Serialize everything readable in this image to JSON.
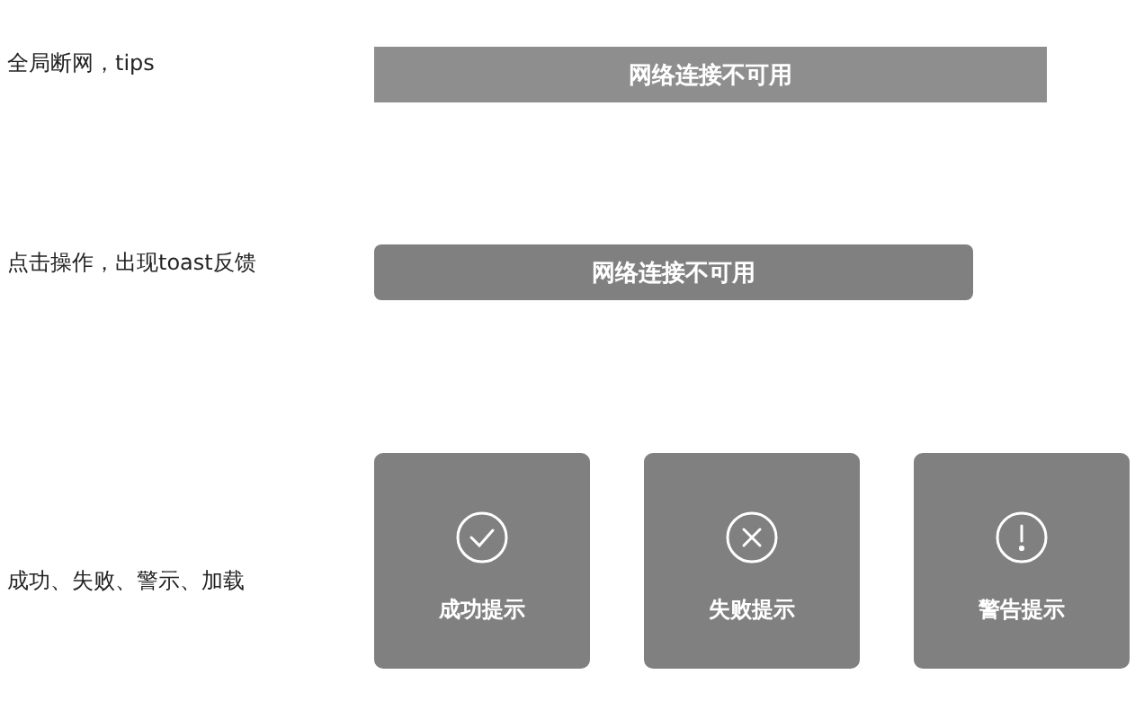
{
  "sections": [
    {
      "label": "全局断网，tips",
      "kind": "banner",
      "message": "网络连接不可用"
    },
    {
      "label": "点击操作，出现toast反馈",
      "kind": "toast",
      "message": "网络连接不可用"
    },
    {
      "label": "成功、失败、警示、加载",
      "kind": "cards",
      "cards": [
        {
          "kind": "success",
          "text": "成功提示"
        },
        {
          "kind": "error",
          "text": "失败提示"
        },
        {
          "kind": "warning",
          "text": "警告提示"
        }
      ]
    }
  ]
}
